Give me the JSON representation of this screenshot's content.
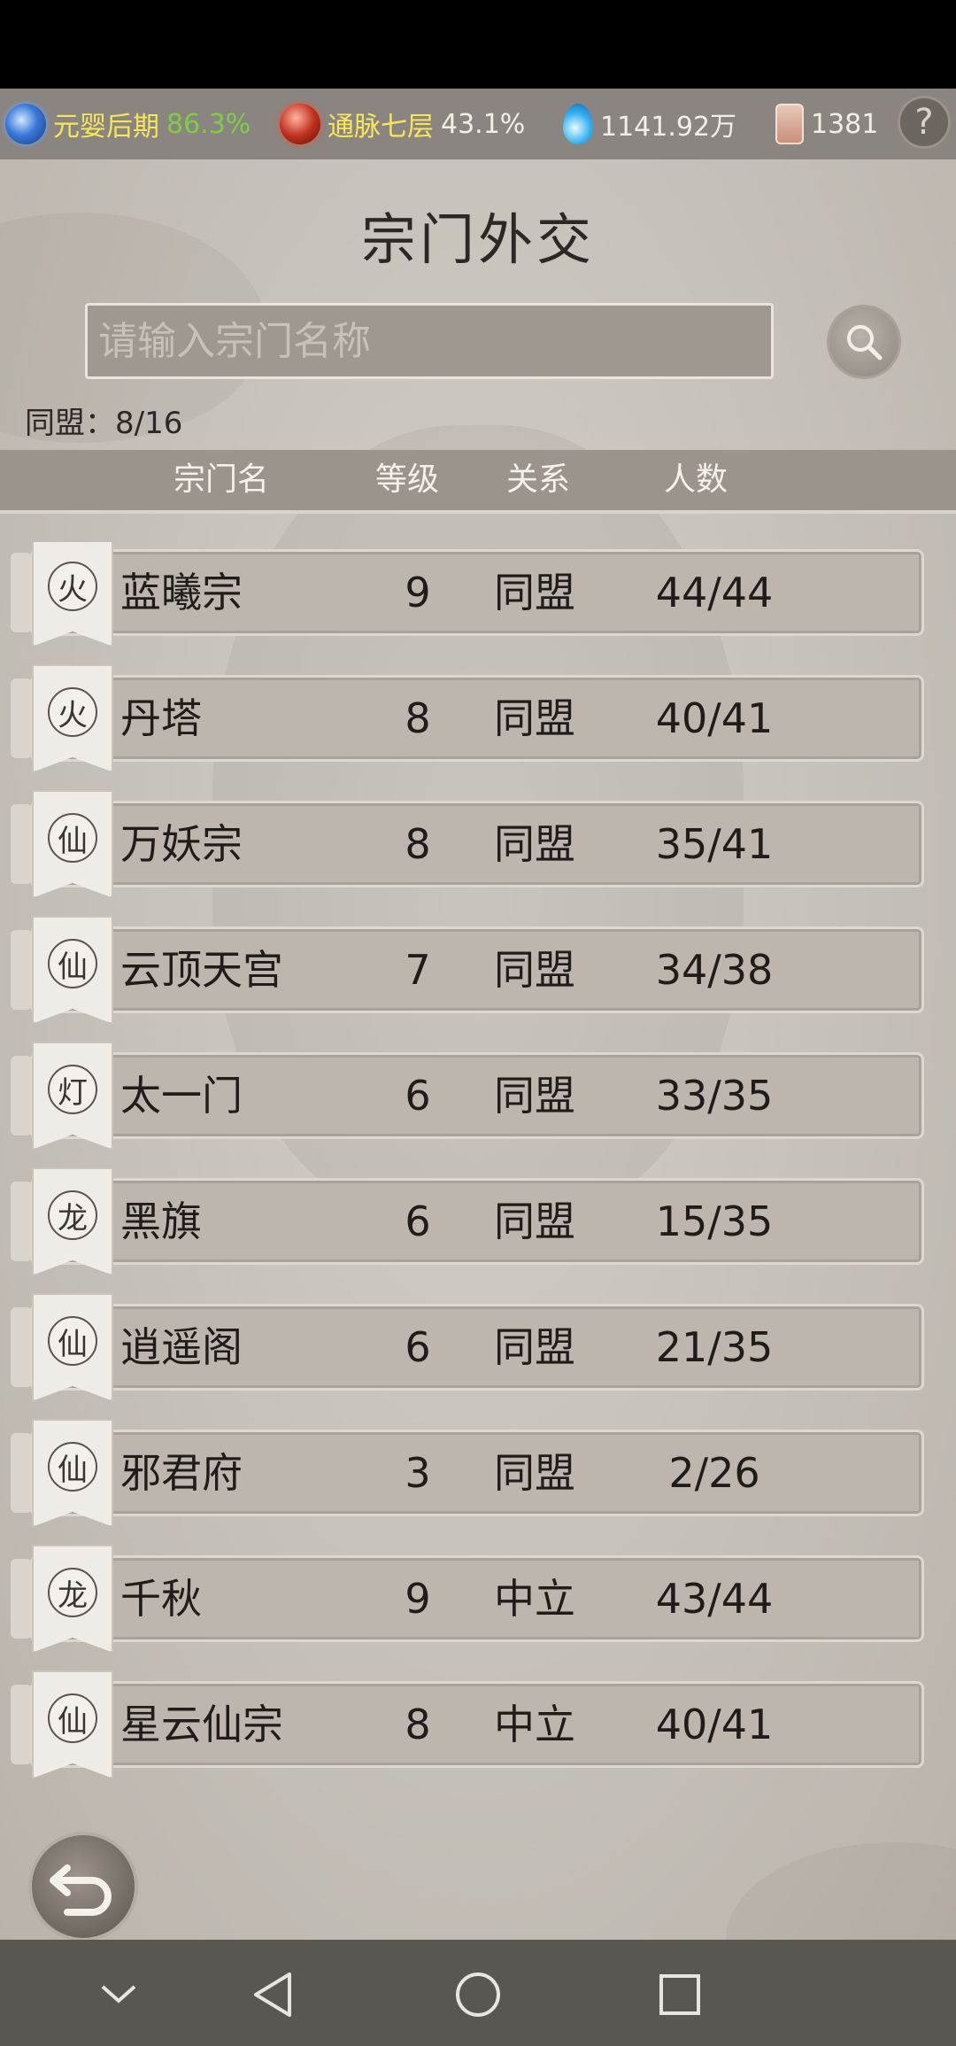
{
  "top_stats": {
    "realm_name": "元婴后期",
    "realm_progress": "86.3%",
    "meridian_name": "通脉七层",
    "meridian_progress": "43.1%",
    "spirit_stone": "1141.92万",
    "token_count": "1381",
    "help_label": "?"
  },
  "page": {
    "title": "宗门外交",
    "search_placeholder": "请输入宗门名称",
    "alliance_label": "同盟：8/16"
  },
  "table": {
    "headers": [
      "宗门名",
      "等级",
      "关系",
      "人数"
    ],
    "rows": [
      {
        "name": "蓝曦宗",
        "level": "9",
        "relation": "同盟",
        "members": "44/44",
        "emblem": "flame-crest-icon",
        "glyph": "火"
      },
      {
        "name": "丹塔",
        "level": "8",
        "relation": "同盟",
        "members": "40/41",
        "emblem": "flame-crest-icon",
        "glyph": "火"
      },
      {
        "name": "万妖宗",
        "level": "8",
        "relation": "同盟",
        "members": "35/41",
        "emblem": "xian-crest-icon",
        "glyph": "仙"
      },
      {
        "name": "云顶天宫",
        "level": "7",
        "relation": "同盟",
        "members": "34/38",
        "emblem": "xian-crest-icon",
        "glyph": "仙"
      },
      {
        "name": "太一门",
        "level": "6",
        "relation": "同盟",
        "members": "33/35",
        "emblem": "lantern-crest-icon",
        "glyph": "灯"
      },
      {
        "name": "黑旗",
        "level": "6",
        "relation": "同盟",
        "members": "15/35",
        "emblem": "dragon-crest-icon",
        "glyph": "龙"
      },
      {
        "name": "逍遥阁",
        "level": "6",
        "relation": "同盟",
        "members": "21/35",
        "emblem": "xian-crest-icon",
        "glyph": "仙"
      },
      {
        "name": "邪君府",
        "level": "3",
        "relation": "同盟",
        "members": "2/26",
        "emblem": "xian-crest-icon",
        "glyph": "仙"
      },
      {
        "name": "千秋",
        "level": "9",
        "relation": "中立",
        "members": "43/44",
        "emblem": "dragon-crest-icon",
        "glyph": "龙"
      },
      {
        "name": "星云仙宗",
        "level": "8",
        "relation": "中立",
        "members": "40/41",
        "emblem": "xian-crest-icon",
        "glyph": "仙"
      }
    ]
  }
}
